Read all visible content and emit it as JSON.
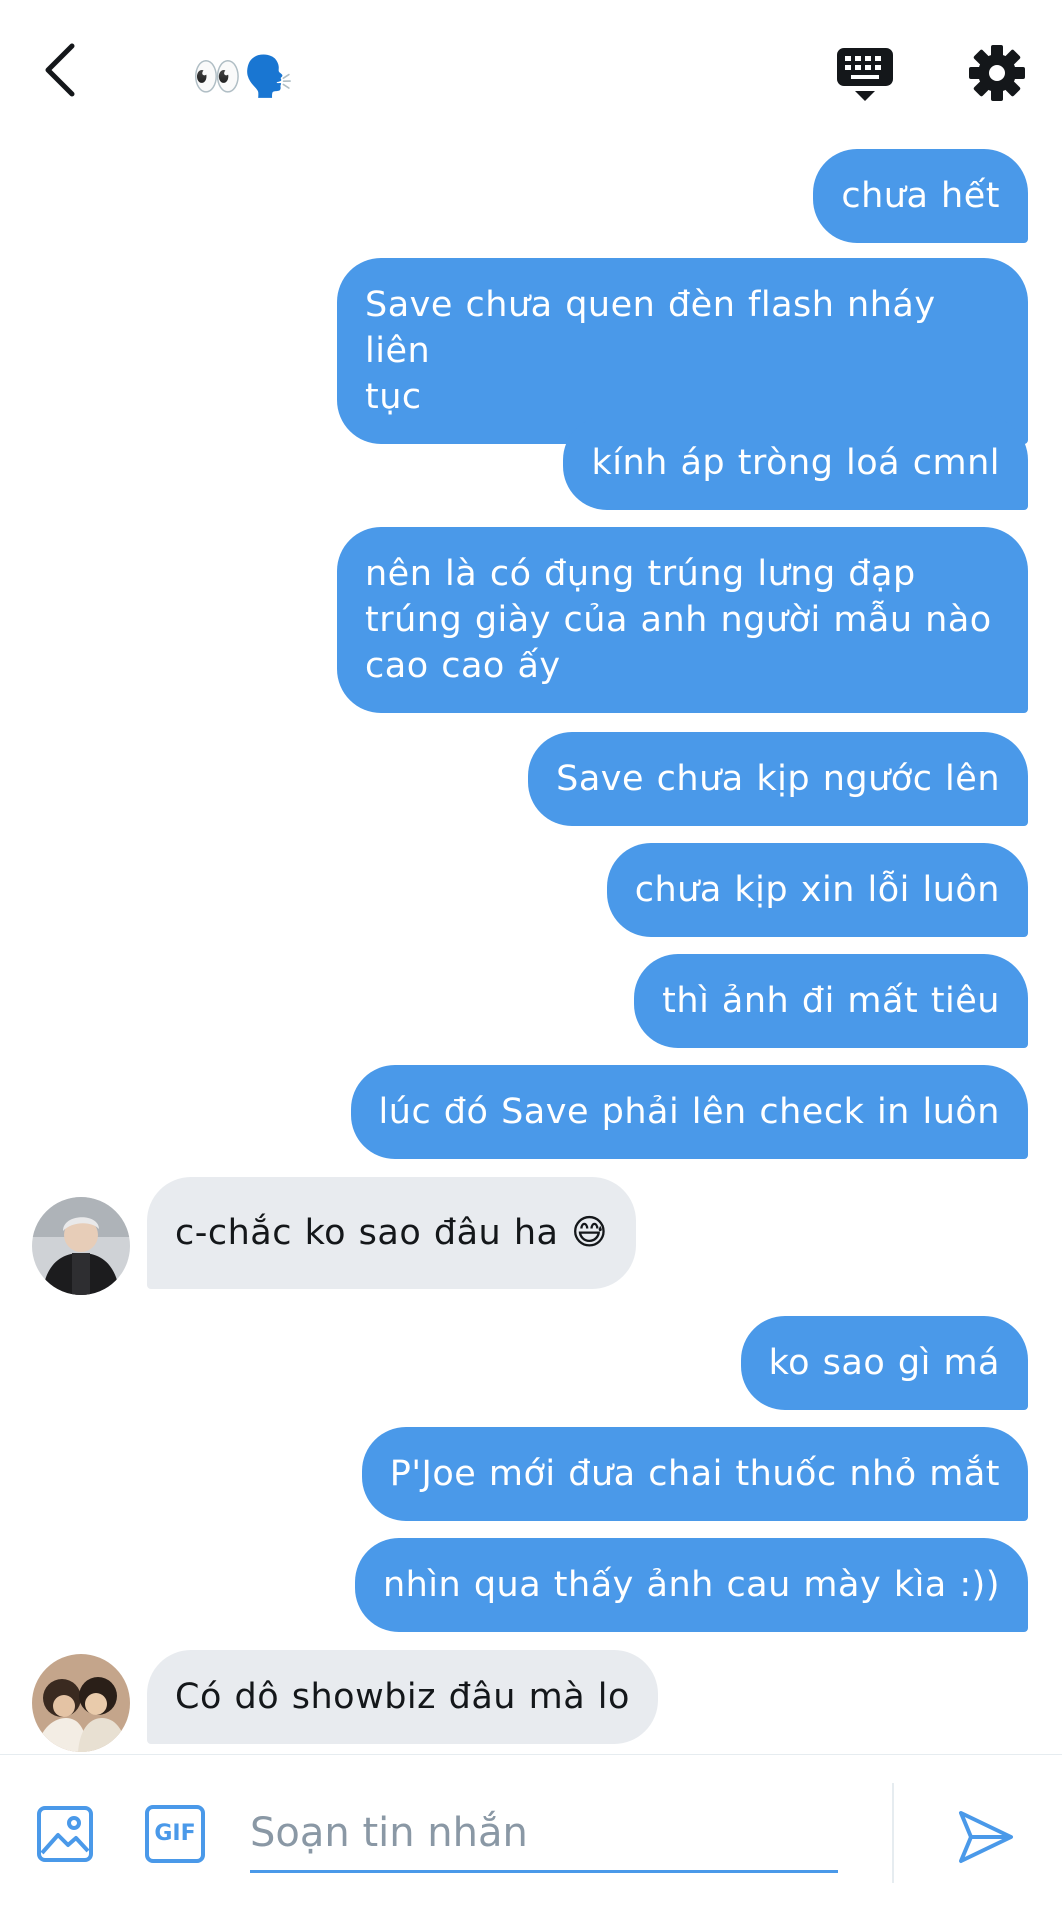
{
  "header": {
    "title": "👀🗣️",
    "back_icon": "back-arrow-icon",
    "keyboard_icon": "keyboard-icon",
    "settings_icon": "gear-icon"
  },
  "messages": [
    {
      "side": "out",
      "text": "chưa hết"
    },
    {
      "side": "out",
      "lines": [
        "Save chưa quen đèn flash nháy liên",
        "tục"
      ]
    },
    {
      "side": "out",
      "text": "kính áp tròng loá cmnl"
    },
    {
      "side": "out",
      "lines": [
        "nên là có đụng trúng lưng đạp",
        "trúng giày của anh người mẫu nào",
        "cao cao ấy"
      ]
    },
    {
      "side": "out",
      "text": "Save chưa kịp ngước lên"
    },
    {
      "side": "out",
      "text": "chưa kịp xin lỗi luôn"
    },
    {
      "side": "out",
      "text": "thì ảnh đi mất tiêu"
    },
    {
      "side": "out",
      "text": "lúc đó Save phải lên check in luôn"
    },
    {
      "side": "in",
      "text": "c-chắc ko sao đâu ha 😅"
    },
    {
      "side": "out",
      "text": "ko sao gì má"
    },
    {
      "side": "out",
      "text": "P'Joe mới đưa chai thuốc nhỏ mắt"
    },
    {
      "side": "out",
      "text": "nhìn qua thấy ảnh cau mày kìa :))"
    },
    {
      "side": "in",
      "text": "Có dô showbiz đâu mà lo"
    }
  ],
  "composer": {
    "placeholder": "Soạn tin nhắn",
    "gif_label": "GIF",
    "image_icon": "image-icon",
    "send_icon": "send-icon"
  },
  "colors": {
    "outgoing_bubble": "#4a99e9",
    "incoming_bubble": "#e8ebef",
    "accent": "#4a99e9"
  }
}
